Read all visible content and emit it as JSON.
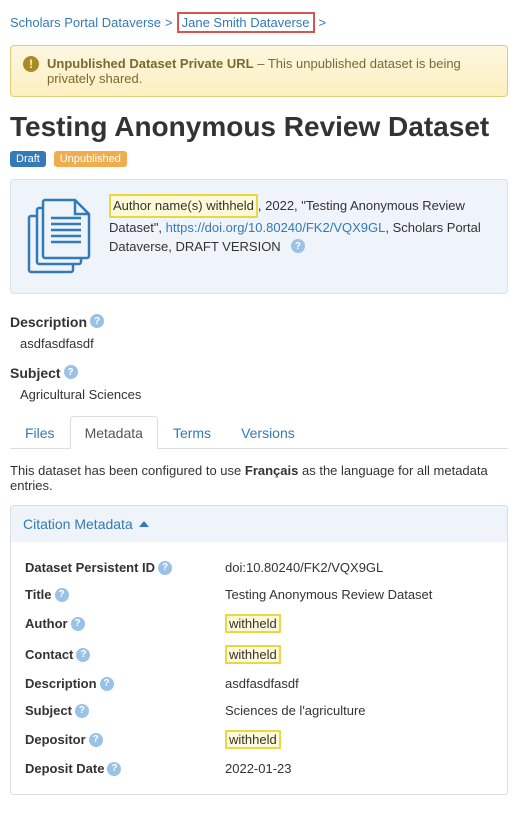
{
  "breadcrumb": {
    "root": "Scholars Portal Dataverse",
    "current": "Jane Smith Dataverse"
  },
  "alert": {
    "title": "Unpublished Dataset Private URL",
    "text": " – This unpublished dataset is being privately shared."
  },
  "title": "Testing Anonymous Review Dataset",
  "badges": {
    "draft": "Draft",
    "unpub": "Unpublished"
  },
  "citation": {
    "author": "Author name(s) withheld",
    "year_sep": ", 2022, \"",
    "dataset_title": "Testing Anonymous Review Dataset",
    "after_title": "\", ",
    "doi": "https://doi.org/10.80240/FK2/VQX9GL",
    "suffix": ", Scholars Portal Dataverse, DRAFT VERSION"
  },
  "fields": [
    {
      "label": "Description",
      "value": "asdfasdfasdf"
    },
    {
      "label": "Subject",
      "value": "Agricultural Sciences"
    }
  ],
  "tabs": {
    "files": "Files",
    "metadata": "Metadata",
    "terms": "Terms",
    "versions": "Versions"
  },
  "lang_note": {
    "pre": "This dataset has been configured to use ",
    "lang": "Français",
    "post": " as the language for all metadata entries."
  },
  "panel_title": "Citation Metadata",
  "metadata": [
    {
      "k": "Dataset Persistent ID",
      "v": "doi:10.80240/FK2/VQX9GL",
      "hl": false
    },
    {
      "k": "Title",
      "v": "Testing Anonymous Review Dataset",
      "hl": false
    },
    {
      "k": "Author",
      "v": "withheld",
      "hl": true
    },
    {
      "k": "Contact",
      "v": "withheld",
      "hl": true
    },
    {
      "k": "Description",
      "v": "asdfasdfasdf",
      "hl": false
    },
    {
      "k": "Subject",
      "v": "Sciences de l'agriculture",
      "hl": false
    },
    {
      "k": "Depositor",
      "v": "withheld",
      "hl": true
    },
    {
      "k": "Deposit Date",
      "v": "2022-01-23",
      "hl": false
    }
  ]
}
